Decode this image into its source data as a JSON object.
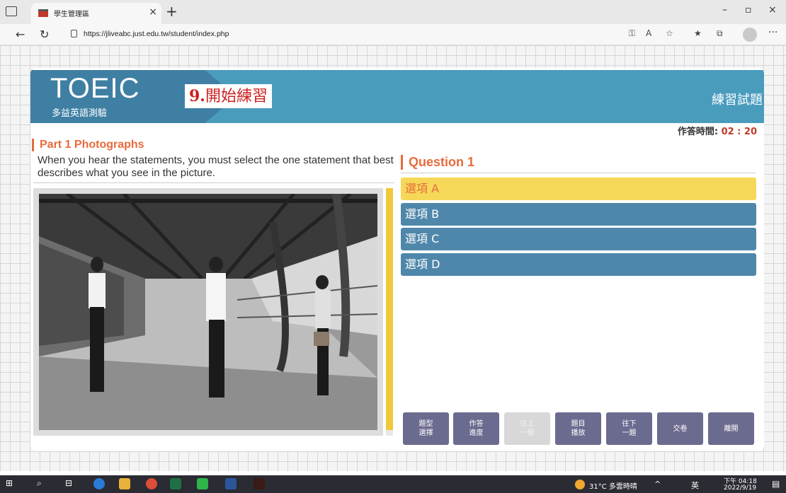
{
  "browser": {
    "tab_title": "學生管理區",
    "url": "https://jliveabc.just.edu.tw/student/index.php"
  },
  "banner": {
    "logo_title": "TOEIC",
    "logo_subtitle": "多益英語測驗",
    "step_number": "9.",
    "step_text": "開始練習",
    "mode_label": "練習試題"
  },
  "timer": {
    "label": "作答時間:",
    "value": "02 : 20"
  },
  "part": {
    "title": "Part 1 Photographs",
    "instructions": "When you hear the statements, you must select the one statement that best describes what you see in the picture."
  },
  "question": {
    "title": "Question 1",
    "options": [
      {
        "label": "選項 A",
        "selected": true
      },
      {
        "label": "選項 B",
        "selected": false
      },
      {
        "label": "選項 C",
        "selected": false
      },
      {
        "label": "選項 D",
        "selected": false
      }
    ]
  },
  "controls": [
    {
      "label": "題型\n選擇",
      "enabled": true
    },
    {
      "label": "作答\n進度",
      "enabled": true
    },
    {
      "label": "往上\n一題",
      "enabled": false
    },
    {
      "label": "題目\n播放",
      "enabled": true
    },
    {
      "label": "往下\n一題",
      "enabled": true
    },
    {
      "label": "交卷",
      "enabled": true
    },
    {
      "label": "離開",
      "enabled": true
    }
  ],
  "taskbar": {
    "weather": "31°C 多雲時晴",
    "ime": "英",
    "time": "下午 04:18",
    "date": "2022/9/19"
  },
  "colors": {
    "accent_orange": "#e86a3d",
    "banner_blue": "#4a9cbd",
    "option_blue": "#4f87ab",
    "option_selected": "#f6d858",
    "control_purple": "#6b6a8f"
  }
}
